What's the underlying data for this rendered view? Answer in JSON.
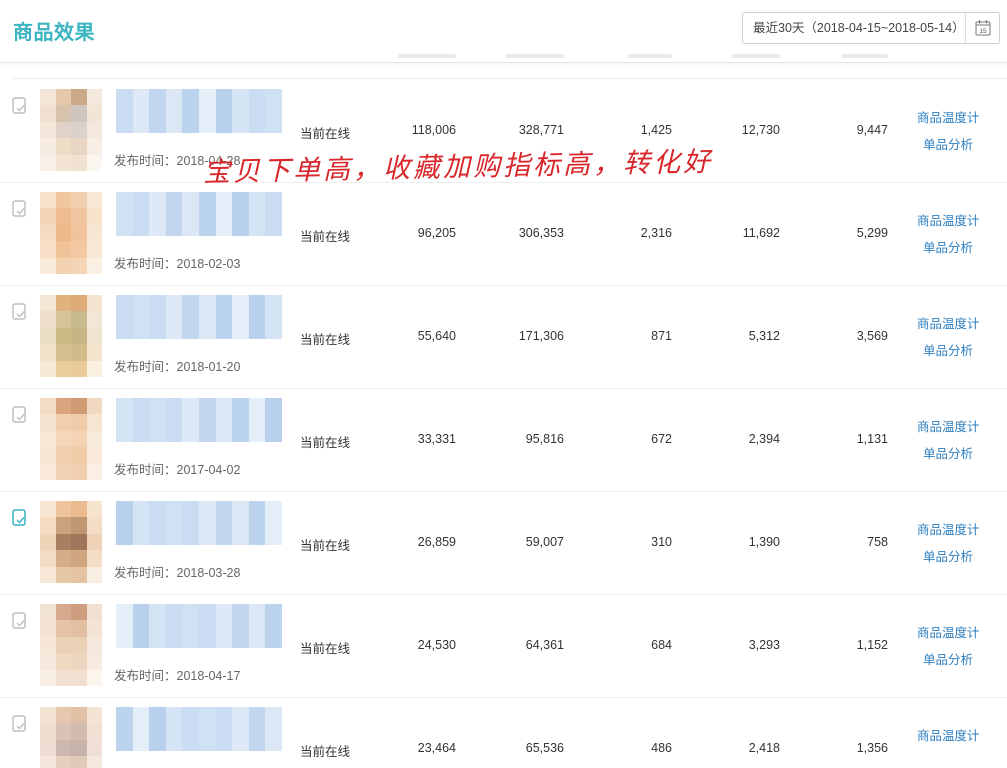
{
  "header": {
    "title": "商品效果",
    "date_range": "最近30天（2018-04-15~2018-05-14）",
    "calendar_day": "15"
  },
  "annotation": "宝贝下单高，收藏加购指标高，转化好",
  "rows": [
    {
      "publish": "发布时间：2018-04-28",
      "status": "当前在线",
      "v1": "118,006",
      "v2": "328,771",
      "v3": "1,425",
      "v4": "12,730",
      "v5": "9,447",
      "link1": "商品温度计",
      "link2": "单品分析"
    },
    {
      "publish": "发布时间：2018-02-03",
      "status": "当前在线",
      "v1": "96,205",
      "v2": "306,353",
      "v3": "2,316",
      "v4": "11,692",
      "v5": "5,299",
      "link1": "商品温度计",
      "link2": "单品分析"
    },
    {
      "publish": "发布时间：2018-01-20",
      "status": "当前在线",
      "v1": "55,640",
      "v2": "171,306",
      "v3": "871",
      "v4": "5,312",
      "v5": "3,569",
      "link1": "商品温度计",
      "link2": "单品分析"
    },
    {
      "publish": "发布时间：2017-04-02",
      "status": "当前在线",
      "v1": "33,331",
      "v2": "95,816",
      "v3": "672",
      "v4": "2,394",
      "v5": "1,131",
      "link1": "商品温度计",
      "link2": "单品分析"
    },
    {
      "publish": "发布时间：2018-03-28",
      "status": "当前在线",
      "v1": "26,859",
      "v2": "59,007",
      "v3": "310",
      "v4": "1,390",
      "v5": "758",
      "link1": "商品温度计",
      "link2": "单品分析"
    },
    {
      "publish": "发布时间：2018-04-17",
      "status": "当前在线",
      "v1": "24,530",
      "v2": "64,361",
      "v3": "684",
      "v4": "3,293",
      "v5": "1,152",
      "link1": "商品温度计",
      "link2": "单品分析"
    },
    {
      "publish": "",
      "status": "当前在线",
      "v1": "23,464",
      "v2": "65,536",
      "v3": "486",
      "v4": "2,418",
      "v5": "1,356",
      "link1": "商品温度计",
      "link2": ""
    }
  ],
  "colors": {
    "accent": "#3bb4c1",
    "link": "#2d7fc1",
    "annotation": "#d8262a"
  }
}
